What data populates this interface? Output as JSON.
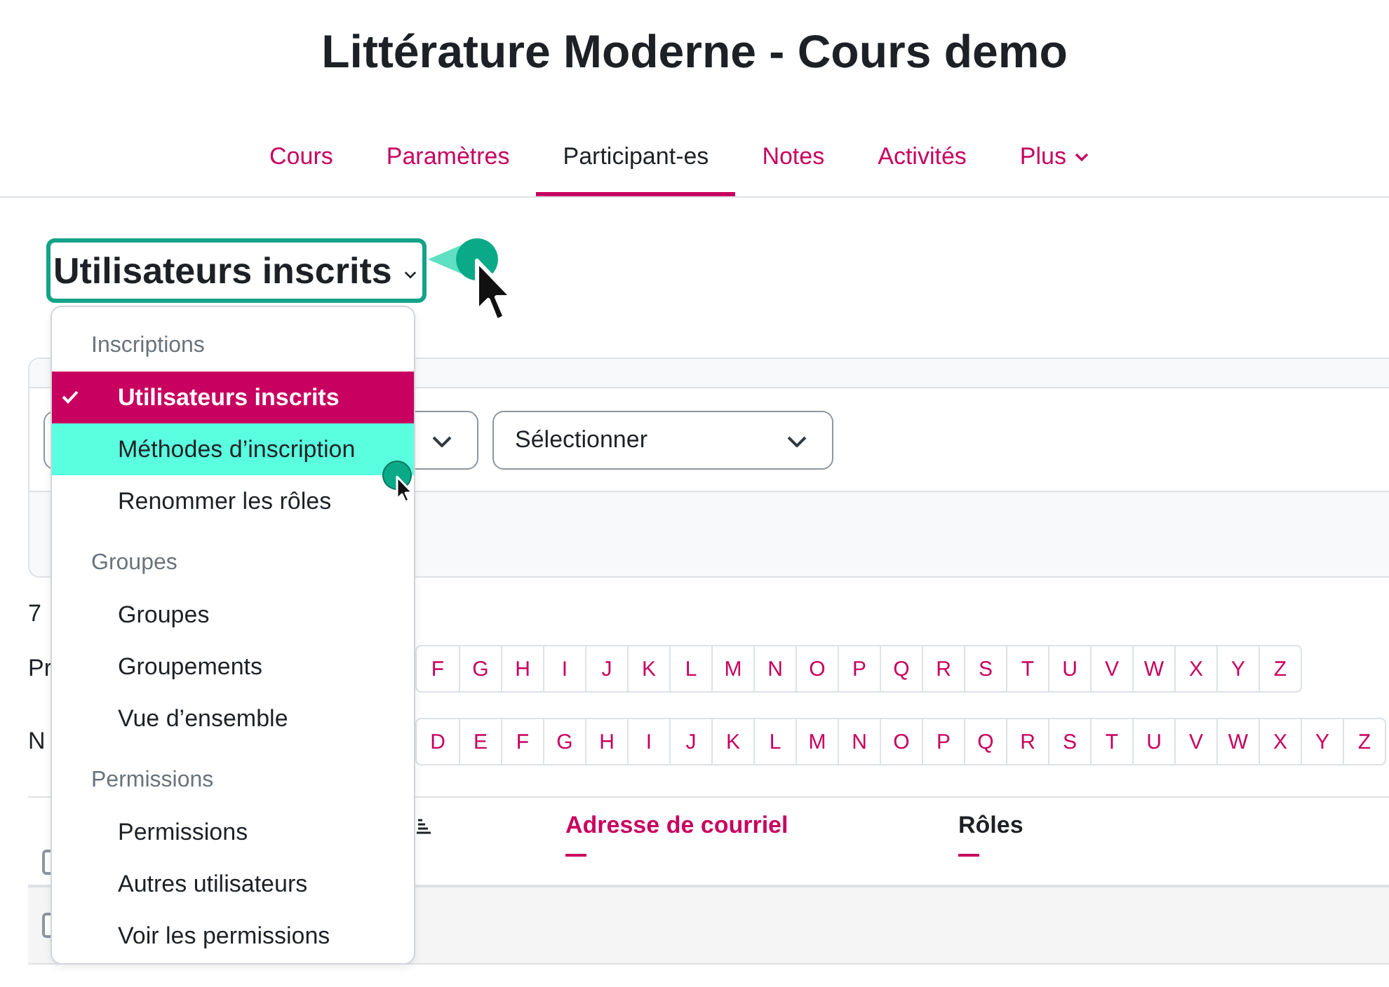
{
  "page_title": "Littérature Moderne - Cours demo",
  "nav_tabs": [
    {
      "label": "Cours",
      "selected": false,
      "dropdown": false
    },
    {
      "label": "Paramètres",
      "selected": false,
      "dropdown": false
    },
    {
      "label": "Participant-es",
      "selected": true,
      "dropdown": false
    },
    {
      "label": "Notes",
      "selected": false,
      "dropdown": false
    },
    {
      "label": "Activités",
      "selected": false,
      "dropdown": false
    },
    {
      "label": "Plus",
      "selected": false,
      "dropdown": true
    }
  ],
  "view_selector": {
    "label": "Utilisateurs inscrits"
  },
  "menu": {
    "sections": [
      {
        "heading": "Inscriptions",
        "items": [
          {
            "label": "Utilisateurs inscrits",
            "selected": true,
            "hovered": false
          },
          {
            "label": "Méthodes d’inscription",
            "selected": false,
            "hovered": true
          },
          {
            "label": "Renommer les rôles",
            "selected": false,
            "hovered": false
          }
        ]
      },
      {
        "heading": "Groupes",
        "items": [
          {
            "label": "Groupes",
            "selected": false,
            "hovered": false
          },
          {
            "label": "Groupements",
            "selected": false,
            "hovered": false
          },
          {
            "label": "Vue d’ensemble",
            "selected": false,
            "hovered": false
          }
        ]
      },
      {
        "heading": "Permissions",
        "items": [
          {
            "label": "Permissions",
            "selected": false,
            "hovered": false
          },
          {
            "label": "Autres utilisateurs",
            "selected": false,
            "hovered": false
          },
          {
            "label": "Voir les permissions",
            "selected": false,
            "hovered": false
          }
        ]
      }
    ]
  },
  "filters": {
    "selects": [
      {
        "value": "Sélectionner"
      }
    ]
  },
  "participant_count": "7",
  "initial_filters": [
    {
      "label": "Pr",
      "letters": [
        "F",
        "G",
        "H",
        "I",
        "J",
        "K",
        "L",
        "M",
        "N",
        "O",
        "P",
        "Q",
        "R",
        "S",
        "T",
        "U",
        "V",
        "W",
        "X",
        "Y",
        "Z"
      ]
    },
    {
      "label": "N",
      "letters": [
        "D",
        "E",
        "F",
        "G",
        "H",
        "I",
        "J",
        "K",
        "L",
        "M",
        "N",
        "O",
        "P",
        "Q",
        "R",
        "S",
        "T",
        "U",
        "V",
        "W",
        "X",
        "Y",
        "Z"
      ]
    }
  ],
  "table": {
    "select_all_checked": false,
    "columns": [
      {
        "label": "Adresse de courriel",
        "link": true
      },
      {
        "label": "Rôles",
        "link": false
      }
    ],
    "rows": [
      {
        "checked": false
      }
    ]
  }
}
